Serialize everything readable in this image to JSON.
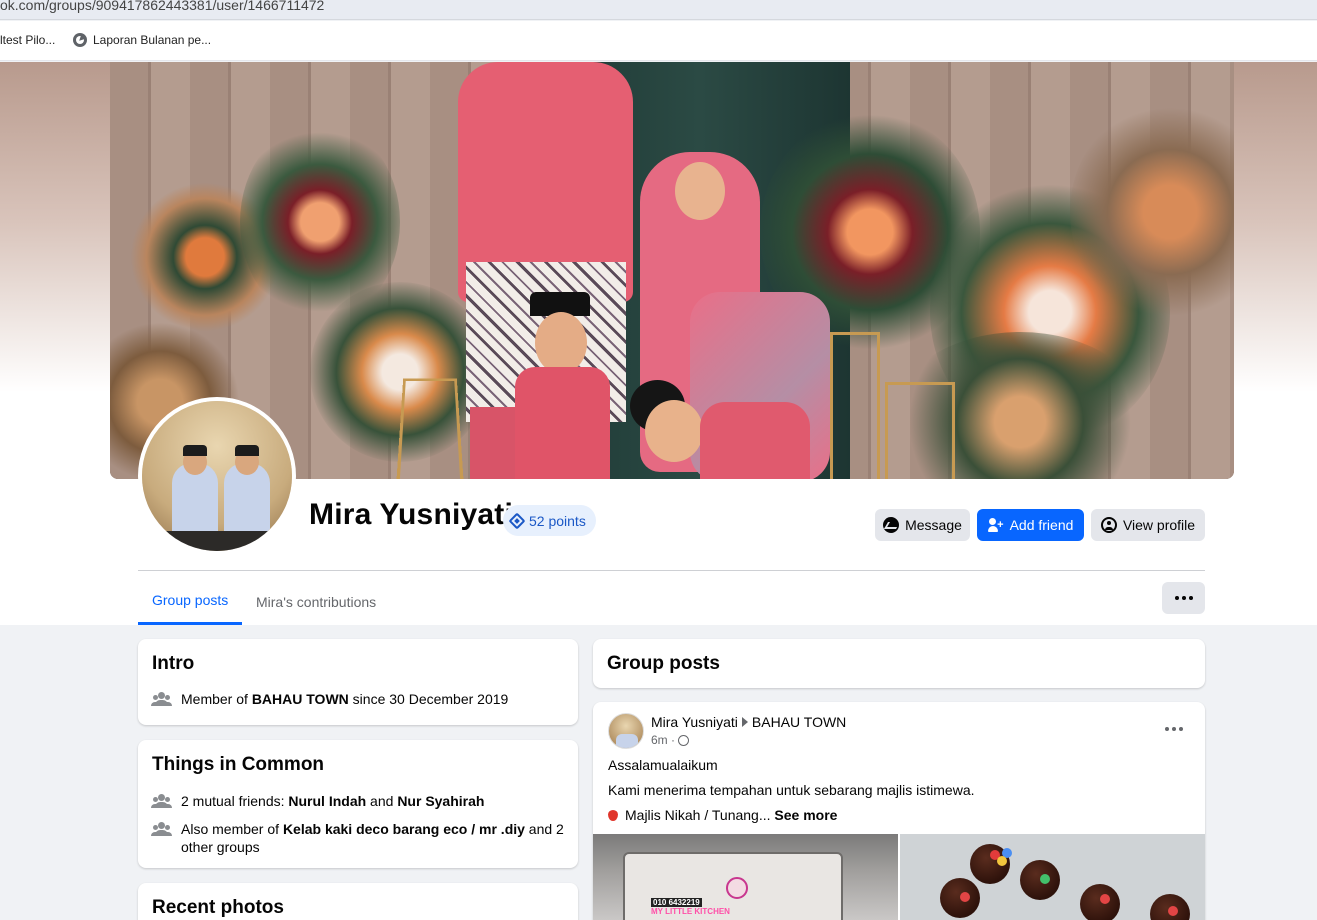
{
  "browser": {
    "url": "ok.com/groups/909417862443381/user/1466711472",
    "bookmarks": [
      {
        "label": "ltest Pilo..."
      },
      {
        "label": "Laporan Bulanan pe..."
      }
    ]
  },
  "profile": {
    "name": "Mira Yusniyati",
    "points": "52 points",
    "actions": {
      "message": "Message",
      "add_friend": "Add friend",
      "view_profile": "View profile"
    }
  },
  "tabs": [
    {
      "label": "Group posts",
      "active": true
    },
    {
      "label": "Mira's contributions",
      "active": false
    }
  ],
  "intro": {
    "title": "Intro",
    "member_prefix": "Member of ",
    "group_name": "BAHAU TOWN",
    "member_suffix": " since 30 December 2019"
  },
  "things_in_common": {
    "title": "Things in Common",
    "mutual_prefix": "2 mutual friends: ",
    "friend1": "Nurul Indah",
    "and_word": " and ",
    "friend2": "Nur Syahirah",
    "also_prefix": "Also member of ",
    "other_group": "Kelab kaki deco barang eco / mr .diy",
    "also_suffix": " and 2 other groups"
  },
  "recent_photos": {
    "title": "Recent photos"
  },
  "group_posts": {
    "title": "Group posts"
  },
  "post": {
    "author": "Mira Yusniyati",
    "group": "BAHAU TOWN",
    "time": "6m ·",
    "line1": "Assalamualaikum",
    "line2": "Kami menerima tempahan untuk sebarang majlis istimewa.",
    "line3": "Majlis Nikah / Tunang... ",
    "see_more": "See more",
    "image1_phone": "010 6432219",
    "image1_brand": "MY LITTLE KITCHEN"
  },
  "colors": {
    "accent": "#0866ff",
    "page_bg": "#f0f2f5",
    "secondary_button": "#e4e6eb",
    "points_badge_bg": "#e7f0fd"
  }
}
